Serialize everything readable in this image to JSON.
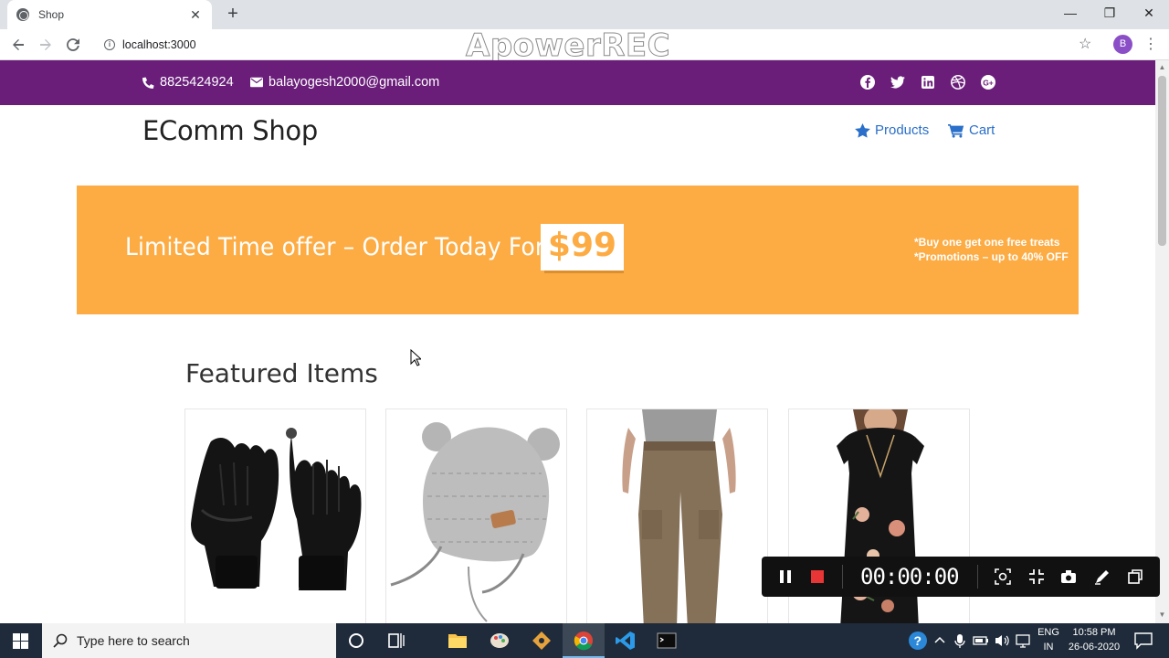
{
  "browser": {
    "tab_title": "Shop",
    "tab_close": "✕",
    "new_tab": "+",
    "url": "localhost:3000",
    "profile_initial": "B",
    "watermark": "ApowerREC",
    "window_controls": {
      "minimize": "—",
      "maximize": "❐",
      "close": "✕"
    }
  },
  "topbar": {
    "phone": "8825424924",
    "email": "balayogesh2000@gmail.com",
    "social_icons": [
      "facebook-icon",
      "twitter-icon",
      "linkedin-icon",
      "dribbble-icon",
      "google-plus-icon"
    ]
  },
  "header": {
    "title": "EComm Shop",
    "nav": {
      "products": "Products",
      "cart": "Cart"
    }
  },
  "promo": {
    "headline": "Limited Time offer – Order Today For",
    "price": "$99",
    "note_1": "*Buy one get one free treats",
    "note_2": "*Promotions – up to 40% OFF"
  },
  "featured": {
    "heading": "Featured Items",
    "items": [
      {
        "image": "black-gloves"
      },
      {
        "image": "grey-knit-beanie"
      },
      {
        "image": "khaki-cargo-pants"
      },
      {
        "image": "floral-black-dress"
      }
    ]
  },
  "recorder": {
    "time": "00:00:00"
  },
  "taskbar": {
    "search_placeholder": "Type here to search",
    "language_1": "ENG",
    "language_2": "IN",
    "time": "10:58 PM",
    "date": "26-06-2020"
  },
  "colors": {
    "topbar": "#6a1e7a",
    "promo": "#fdac44",
    "link": "#2a6fc9"
  }
}
